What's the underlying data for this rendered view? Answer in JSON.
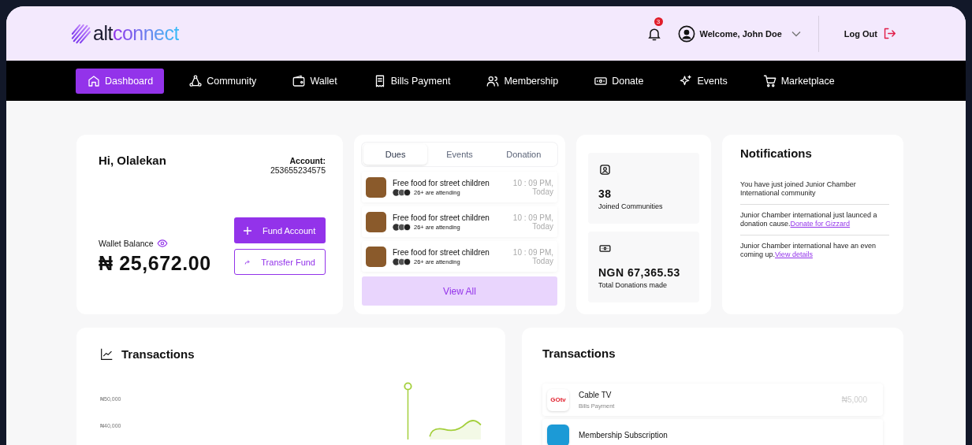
{
  "header": {
    "logo": {
      "prefix": "alt",
      "suffix": "connect"
    },
    "notification_count": "3",
    "welcome": "Welcome, John Doe",
    "logout": "Log Out"
  },
  "nav": [
    {
      "label": "Dashboard",
      "selected": true
    },
    {
      "label": "Community",
      "selected": false
    },
    {
      "label": "Wallet",
      "selected": false
    },
    {
      "label": "Bills Payment",
      "selected": false
    },
    {
      "label": "Membership",
      "selected": false
    },
    {
      "label": "Donate",
      "selected": false
    },
    {
      "label": "Events",
      "selected": false
    },
    {
      "label": "Marketplace",
      "selected": false
    }
  ],
  "account_card": {
    "greeting": "Hi, Olalekan",
    "account_label": "Account:",
    "account_number": "253655234575",
    "balance_label": "Wallet Balance",
    "balance": "₦ 25,672.00",
    "fund_button": "Fund Account",
    "transfer_button": "Transfer Fund"
  },
  "activity": {
    "tabs": [
      {
        "label": "Dues",
        "selected": true
      },
      {
        "label": "Events",
        "selected": false
      },
      {
        "label": "Donation",
        "selected": false
      }
    ],
    "items": [
      {
        "title": "Free food for street children",
        "attendees": "26+ are attending",
        "time": "10 : 09 PM,",
        "day": "Today"
      },
      {
        "title": "Free food for street children",
        "attendees": "26+ are attending",
        "time": "10 : 09 PM,",
        "day": "Today"
      },
      {
        "title": "Free food for street children",
        "attendees": "26+ are attending",
        "time": "10 : 09 PM,",
        "day": "Today"
      }
    ],
    "view_all": "View All"
  },
  "stats": [
    {
      "value": "38",
      "label": "Joined Communities"
    },
    {
      "value": "NGN 67,365.53",
      "label": "Total Donations made"
    }
  ],
  "notifications": {
    "title": "Notifications",
    "items": [
      {
        "text": "You have just joined Junior Chamber International community"
      },
      {
        "text": "Junior Chamber international just launced a donation cause.",
        "link": "Donate for Gizzard"
      },
      {
        "text": "Junior Chamber international have an even coming up.",
        "link": "View details"
      }
    ]
  },
  "transactions_chart": {
    "title": "Transactions",
    "y_labels": [
      "₦50,000",
      "₦40,000"
    ]
  },
  "transactions_list": {
    "title": "Transactions",
    "items": [
      {
        "logo_text": "GOtv",
        "title": "Cable TV",
        "category": "Bills Payment",
        "amount": "₦5,000"
      },
      {
        "title": "Membership Subscription"
      }
    ]
  }
}
